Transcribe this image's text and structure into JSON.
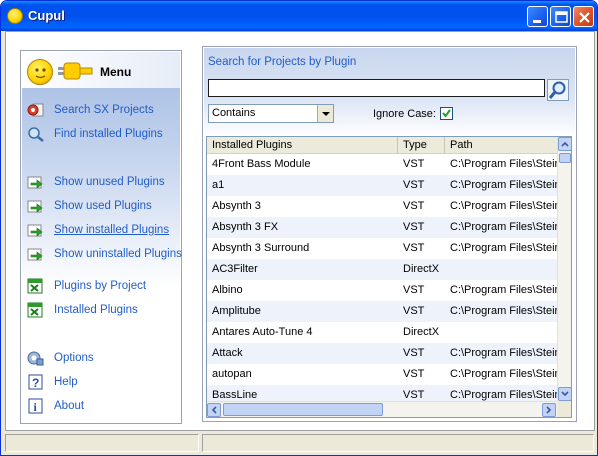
{
  "window": {
    "title": "Cupul",
    "controls": {
      "minimize": "minimize-icon",
      "maximize": "maximize-icon",
      "close": "close-icon"
    }
  },
  "menu": {
    "title": "Menu",
    "items": [
      {
        "label": "Search SX Projects",
        "icon": "search-projects-icon"
      },
      {
        "label": "Find installed Plugins",
        "icon": "find-plugins-icon"
      },
      {
        "label": "Show unused Plugins",
        "icon": "green-arrow-icon"
      },
      {
        "label": "Show used Plugins",
        "icon": "green-arrow-icon"
      },
      {
        "label": "Show installed Plugins",
        "icon": "green-arrow-icon"
      },
      {
        "label": "Show uninstalled Plugins",
        "icon": "green-arrow-icon"
      },
      {
        "label": "Plugins by Project",
        "icon": "excel-icon"
      },
      {
        "label": "Installed Plugins",
        "icon": "excel-icon"
      },
      {
        "label": "Options",
        "icon": "options-icon"
      },
      {
        "label": "Help",
        "icon": "help-icon"
      },
      {
        "label": "About",
        "icon": "info-icon"
      }
    ]
  },
  "search": {
    "title": "Search for Projects by Plugin",
    "query": "",
    "match_mode": "Contains",
    "ignore_case_label": "Ignore Case:",
    "ignore_case_checked": true
  },
  "table": {
    "columns": [
      "Installed Plugins",
      "Type",
      "Path"
    ],
    "rows": [
      [
        "4Front Bass Module",
        "VST",
        "C:\\Program Files\\Steinberg"
      ],
      [
        "a1",
        "VST",
        "C:\\Program Files\\Steinberg"
      ],
      [
        "Absynth 3",
        "VST",
        "C:\\Program Files\\Steinberg"
      ],
      [
        "Absynth 3 FX",
        "VST",
        "C:\\Program Files\\Steinberg"
      ],
      [
        "Absynth 3 Surround",
        "VST",
        "C:\\Program Files\\Steinberg"
      ],
      [
        "AC3Filter",
        "DirectX",
        ""
      ],
      [
        "Albino",
        "VST",
        "C:\\Program Files\\Steinberg"
      ],
      [
        "Amplitube",
        "VST",
        "C:\\Program Files\\Steinberg"
      ],
      [
        "Antares Auto-Tune 4",
        "DirectX",
        ""
      ],
      [
        "Attack",
        "VST",
        "C:\\Program Files\\Steinberg"
      ],
      [
        "autopan",
        "VST",
        "C:\\Program Files\\Steinberg"
      ],
      [
        "BassLine",
        "VST",
        "C:\\Program Files\\Steinberg"
      ]
    ]
  },
  "colors": {
    "link": "#215dc6",
    "titlebar": "#0050ee",
    "row_alt": "#eef3fb"
  }
}
